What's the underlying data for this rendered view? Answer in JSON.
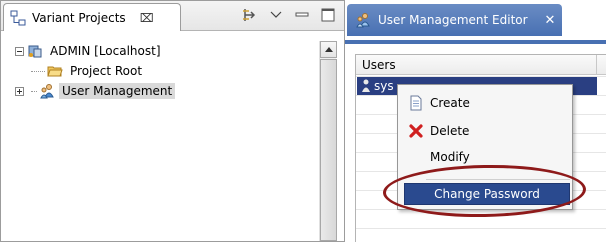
{
  "left_view": {
    "tab_title": "Variant Projects",
    "tab_close_symbol": "⌧"
  },
  "tree": {
    "items": [
      {
        "label": "ADMIN  [Localhost]",
        "icon": "server-icon"
      },
      {
        "label": "Project Root",
        "icon": "folder-open-icon"
      },
      {
        "label": "User Management",
        "icon": "users-icon"
      }
    ]
  },
  "editor": {
    "tab_title": "User Management Editor",
    "close_symbol": "✕",
    "table_header": "Users",
    "user_row": "sys"
  },
  "context_menu": {
    "items": [
      {
        "label": "Create",
        "icon": "document-icon"
      },
      {
        "label": "Delete",
        "icon": "red-x-icon"
      },
      {
        "label": "Modify",
        "icon": ""
      },
      {
        "label": "Change Password",
        "icon": ""
      }
    ]
  },
  "colors": {
    "editor_tab": "#4870b2",
    "selection": "#2a3f82",
    "annotation": "#8e1a1a"
  }
}
